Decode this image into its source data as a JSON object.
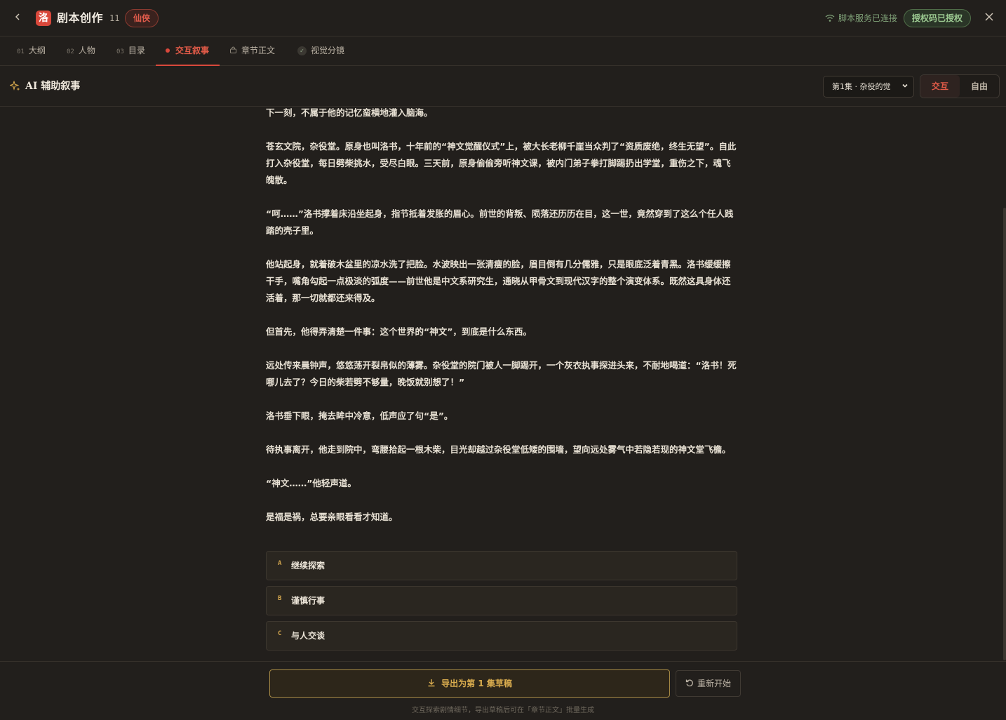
{
  "header": {
    "back_icon": "chevron-left-icon",
    "logo_char": "洛",
    "title": "剧本创作",
    "count": "11",
    "genre": "仙侠",
    "connection_status": "脚本服务已连接",
    "auth_badge": "授权码已授权",
    "close_icon": "close-icon"
  },
  "tabs": [
    {
      "num": "01",
      "label": "大纲",
      "state": "normal"
    },
    {
      "num": "02",
      "label": "人物",
      "state": "normal"
    },
    {
      "num": "03",
      "label": "目录",
      "state": "normal"
    },
    {
      "num": "",
      "label": "交互叙事",
      "state": "active"
    },
    {
      "num": "",
      "label": "章节正文",
      "state": "locked"
    },
    {
      "num": "",
      "label": "视觉分镜",
      "state": "done"
    }
  ],
  "section": {
    "title": "AI 辅助叙事",
    "episode_select": "第1集 · 杂役的觉",
    "modes": [
      "交互",
      "自由"
    ],
    "active_mode": "交互"
  },
  "story": {
    "paragraphs": [
      "下一刻，不属于他的记忆蛮横地灌入脑海。",
      "苍玄文院，杂役堂。原身也叫洛书，十年前的“神文觉醒仪式”上，被大长老柳千崖当众判了“资质废绝，终生无望”。自此打入杂役堂，每日劈柴挑水，受尽白眼。三天前，原身偷偷旁听神文课，被内门弟子拳打脚踢扔出学堂，重伤之下，魂飞魄散。",
      "“呵……”洛书撑着床沿坐起身，指节抵着发胀的眉心。前世的背叛、陨落还历历在目，这一世，竟然穿到了这么个任人践踏的壳子里。",
      "他站起身，就着破木盆里的凉水洗了把脸。水波映出一张清瘦的脸，眉目倒有几分儒雅，只是眼底泛着青黑。洛书缓缓擦干手，嘴角勾起一点极淡的弧度——前世他是中文系研究生，通晓从甲骨文到现代汉字的整个演变体系。既然这具身体还活着，那一切就都还来得及。",
      "但首先，他得弄清楚一件事：这个世界的“神文”，到底是什么东西。",
      "远处传来晨钟声，悠悠荡开裂帛似的薄雾。杂役堂的院门被人一脚踢开，一个灰衣执事探进头来，不耐地喝道：“洛书！死哪儿去了？今日的柴若劈不够量，晚饭就别想了！”",
      "洛书垂下眼，掩去眸中冷意，低声应了句“是”。",
      "待执事离开，他走到院中，弯腰拾起一根木柴，目光却越过杂役堂低矮的围墙，望向远处雾气中若隐若现的神文堂飞檐。",
      "“神文……”他轻声道。",
      "是福是祸，总要亲眼看看才知道。"
    ],
    "options": [
      {
        "letter": "A",
        "label": "继续探索"
      },
      {
        "letter": "B",
        "label": "谨慎行事"
      },
      {
        "letter": "C",
        "label": "与人交谈"
      }
    ]
  },
  "footer": {
    "export_label": "导出为第 1 集草稿",
    "restart_label": "重新开始",
    "hint": "交互探索剧情细节，导出草稿后可在「章节正文」批量生成"
  },
  "colors": {
    "background": "#221f1c",
    "accent_red": "#d9483b",
    "accent_gold": "#d9ac4e",
    "status_green": "#7fa077"
  }
}
